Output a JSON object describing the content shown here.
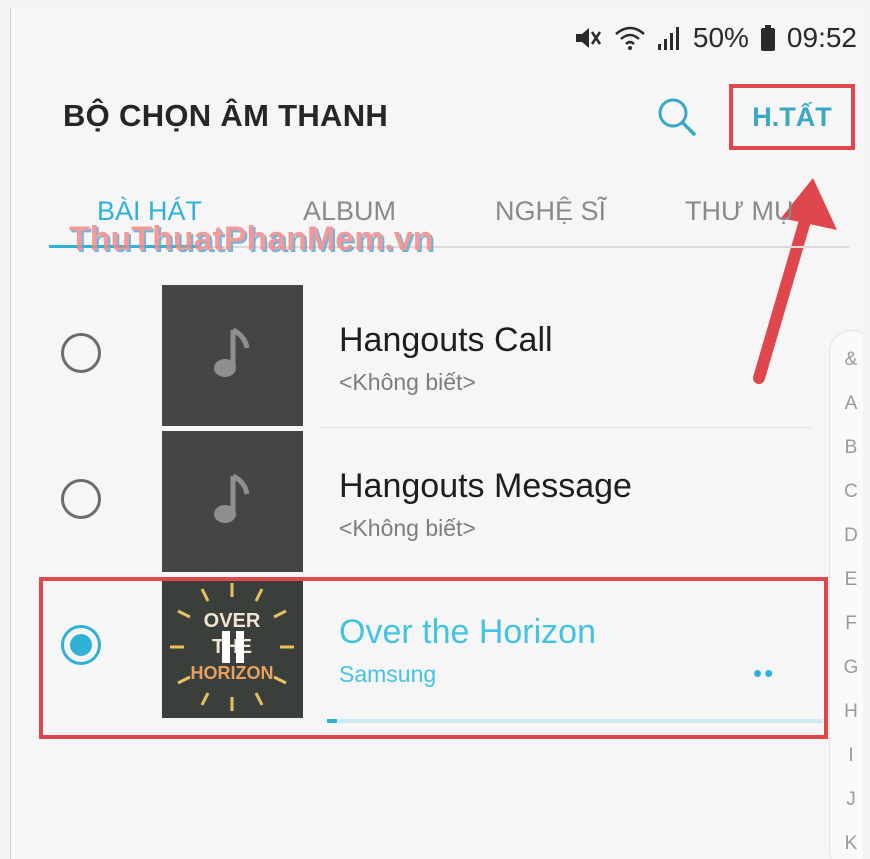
{
  "status_bar": {
    "battery_percent": "50%",
    "time": "09:52",
    "icons": [
      "mute-icon",
      "wifi-icon",
      "signal-icon",
      "battery-icon"
    ]
  },
  "header": {
    "title": "BỘ CHỌN ÂM THANH",
    "done_label": "H.TẤT",
    "search_icon": "search-icon"
  },
  "tabs": [
    {
      "label": "BÀI HÁT",
      "active": true
    },
    {
      "label": "ALBUM",
      "active": false
    },
    {
      "label": "NGHỆ SĨ",
      "active": false
    },
    {
      "label": "THƯ MỤ",
      "active": false
    }
  ],
  "watermark": "ThuThuatPhanMem.vn",
  "songs": [
    {
      "title": "Hangouts Call",
      "artist": "<Không biết>",
      "selected": false,
      "art": "music-note-icon"
    },
    {
      "title": "Hangouts Message",
      "artist": "<Không biết>",
      "selected": false,
      "art": "music-note-icon"
    },
    {
      "title": "Over the Horizon",
      "artist": "Samsung",
      "selected": true,
      "art": "album-art",
      "art_text": "OVER THE HORIZON",
      "more": "••",
      "progress": 0.02
    }
  ],
  "index_letters": [
    "&",
    "A",
    "B",
    "C",
    "D",
    "E",
    "F",
    "G",
    "H",
    "I",
    "J",
    "K"
  ],
  "colors": {
    "accent": "#2fb2d6",
    "annotation_red": "#e0474c",
    "thumb_bg": "#454545"
  }
}
